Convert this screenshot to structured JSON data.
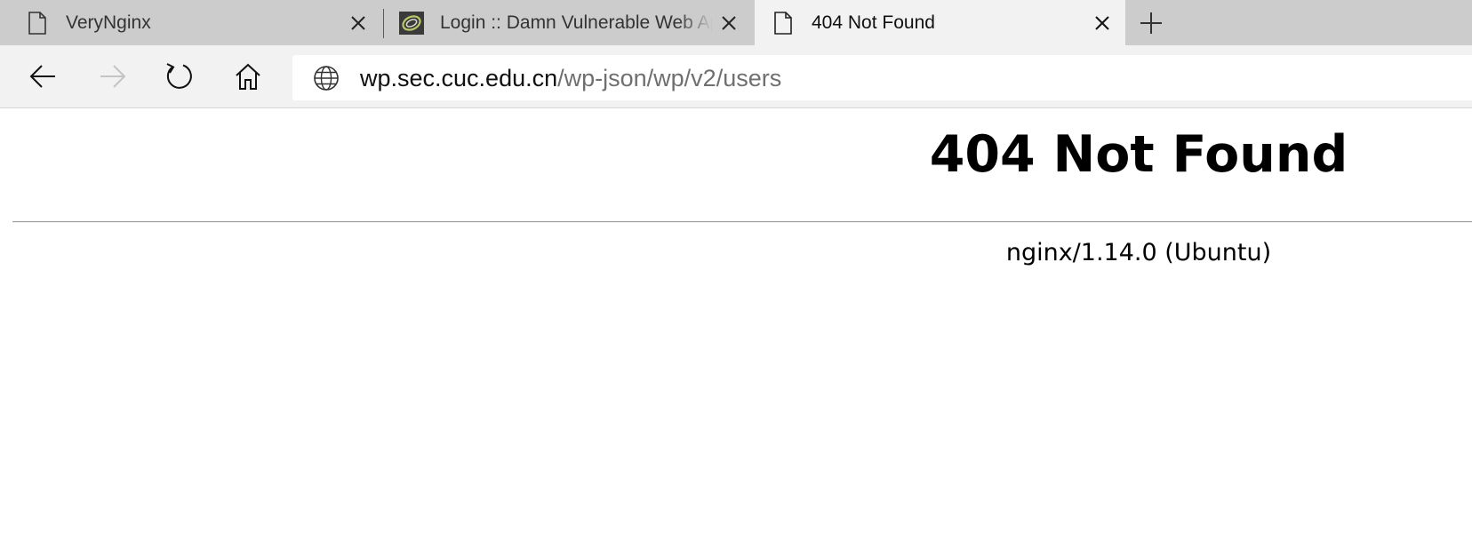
{
  "browser": {
    "tabs": [
      {
        "label": "VeryNginx",
        "icon": "page-icon",
        "active": false
      },
      {
        "label": "Login :: Damn Vulnerable Web App",
        "icon": "dvwa-favicon",
        "active": false
      },
      {
        "label": "404 Not Found",
        "icon": "page-icon",
        "active": true
      }
    ],
    "address": {
      "host": "wp.sec.cuc.edu.cn",
      "path": "/wp-json/wp/v2/users"
    },
    "colors": {
      "tabbar": "#cccccc",
      "active_tab": "#f2f2f2",
      "toolbar": "#f2f2f2"
    }
  },
  "page": {
    "title": "404 Not Found",
    "server": "nginx/1.14.0 (Ubuntu)"
  }
}
